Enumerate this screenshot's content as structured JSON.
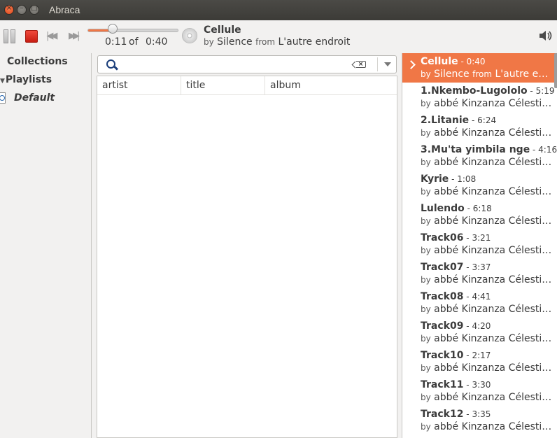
{
  "window": {
    "title": "Abraca"
  },
  "player": {
    "elapsed": "0:11",
    "of_label": "of",
    "total": "0:40",
    "progress": 0.275,
    "now_playing": {
      "title": "Cellule",
      "by_label": "by",
      "artist": "Silence",
      "from_label": "from",
      "album": "L'autre endroit"
    }
  },
  "sidebar": {
    "collections_label": "Collections",
    "playlists_label": "Playlists",
    "playlist_items": [
      {
        "label": "Default"
      }
    ]
  },
  "search": {
    "value": "",
    "placeholder": ""
  },
  "table": {
    "columns": [
      "artist",
      "title",
      "album"
    ]
  },
  "playlist": {
    "items": [
      {
        "title": "Cellule",
        "duration": "0:40",
        "by_label": "by",
        "artist": "Silence",
        "from_label": "from",
        "album": "L'autre endr…",
        "active": true
      },
      {
        "title": "1.Nkembo-Lugololo",
        "duration": "5:19",
        "by_label": "by",
        "artist": "abbé Kinzanza Célestin …"
      },
      {
        "title": "2.Litanie",
        "duration": "6:24",
        "by_label": "by",
        "artist": "abbé Kinzanza Célestin …"
      },
      {
        "title": "3.Mu'ta yimbila nge",
        "duration": "4:16",
        "by_label": "by",
        "artist": "abbé Kinzanza Célestin …"
      },
      {
        "title": "Kyrie",
        "duration": "1:08",
        "by_label": "by",
        "artist": "abbé Kinzanza Célestin …"
      },
      {
        "title": "Lulendo",
        "duration": "6:18",
        "by_label": "by",
        "artist": "abbé Kinzanza Célestin …"
      },
      {
        "title": "Track06",
        "duration": "3:21",
        "by_label": "by",
        "artist": "abbé Kinzanza Célestin …"
      },
      {
        "title": "Track07",
        "duration": "3:37",
        "by_label": "by",
        "artist": "abbé Kinzanza Célestin …"
      },
      {
        "title": "Track08",
        "duration": "4:41",
        "by_label": "by",
        "artist": "abbé Kinzanza Célestin …"
      },
      {
        "title": "Track09",
        "duration": "4:20",
        "by_label": "by",
        "artist": "abbé Kinzanza Célestin …"
      },
      {
        "title": "Track10",
        "duration": "2:17",
        "by_label": "by",
        "artist": "abbé Kinzanza Célestin …"
      },
      {
        "title": "Track11",
        "duration": "3:30",
        "by_label": "by",
        "artist": "abbé Kinzanza Célestin …"
      },
      {
        "title": "Track12",
        "duration": "3:35",
        "by_label": "by",
        "artist": "abbé Kinzanza Célestin …"
      }
    ]
  },
  "colors": {
    "accent": "#f07746",
    "stop": "#d9261a",
    "titlebar": "#3c3b37"
  }
}
